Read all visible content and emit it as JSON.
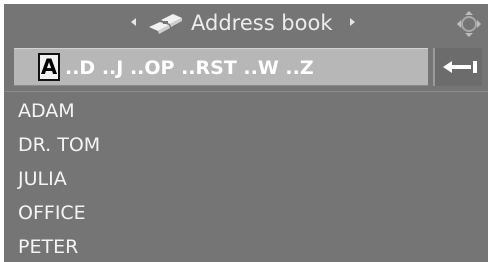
{
  "header": {
    "title": "Address book",
    "book_icon": "address-book-icon",
    "prev_icon": "triangle-left-icon",
    "next_icon": "triangle-right-icon",
    "controller_icon": "controller-joystick-icon"
  },
  "alphabet_bar": {
    "selected_letter": "A",
    "range_text": "..D ..J ..OP ..RST ..W ..Z",
    "back_icon": "back-arrow-icon"
  },
  "contacts": [
    {
      "name": "ADAM"
    },
    {
      "name": "DR. TOM"
    },
    {
      "name": "JULIA"
    },
    {
      "name": "OFFICE"
    },
    {
      "name": "PETER"
    }
  ],
  "colors": {
    "screen_background": "#757575",
    "selection_bar": "#b7b7b7",
    "text": "#f4f4f4"
  }
}
